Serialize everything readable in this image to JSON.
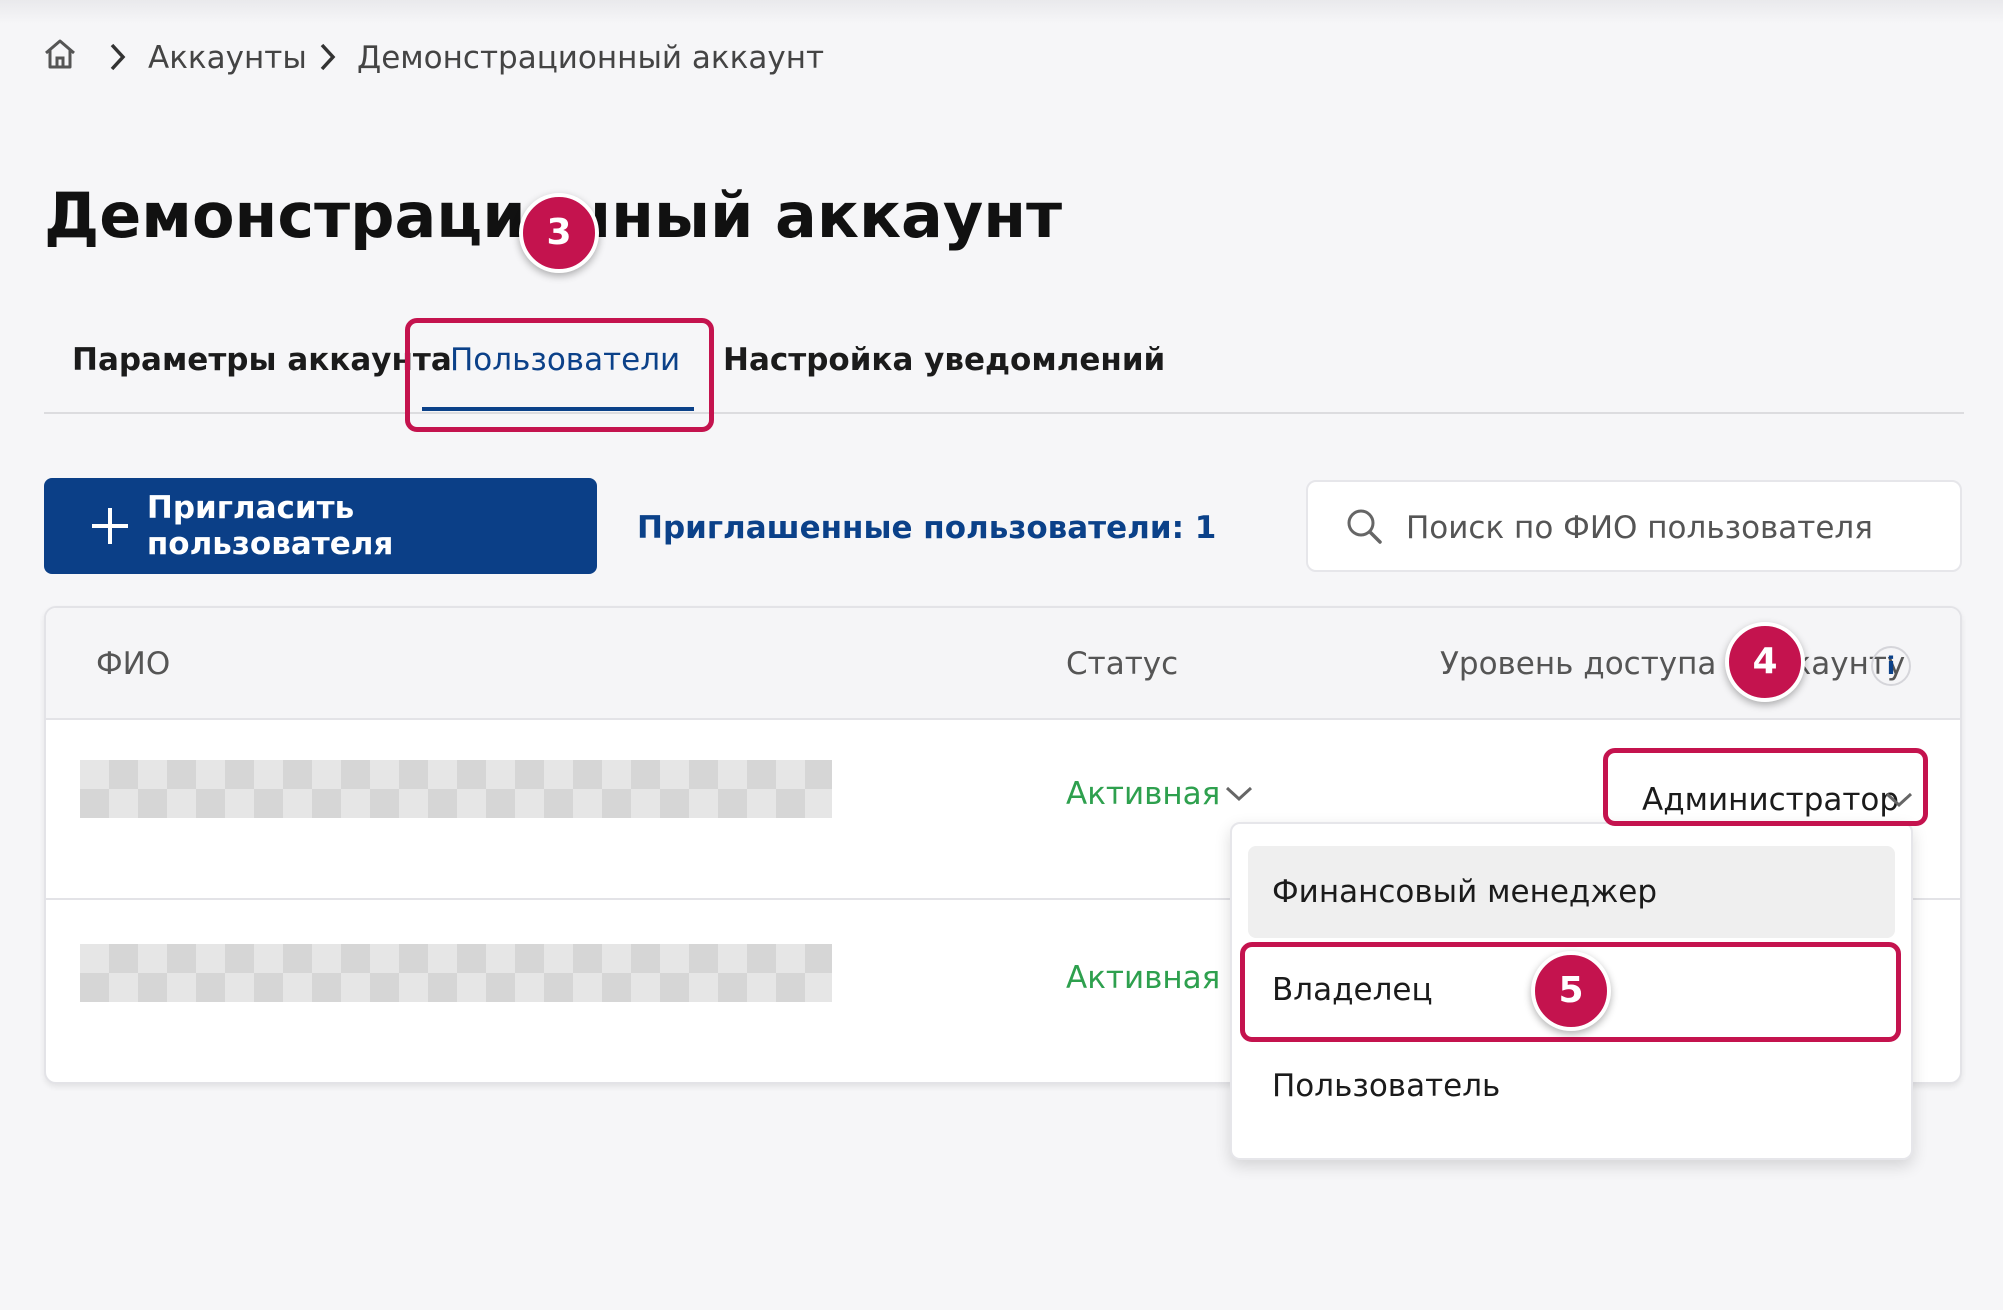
{
  "breadcrumb": {
    "home_icon": "home-icon",
    "items": [
      "Аккаунты",
      "Демонстрационный аккаунт"
    ]
  },
  "page_title": "Демонстрационный аккаунт",
  "tabs": [
    {
      "label": "Параметры аккаунта",
      "active": false
    },
    {
      "label": "Пользователи",
      "active": true
    },
    {
      "label": "Настройка уведомлений",
      "active": false
    }
  ],
  "toolbar": {
    "invite_label": "Пригласить пользователя",
    "invited_link": "Приглашенные пользователи: 1",
    "search_placeholder": "Поиск по ФИО пользователя"
  },
  "table": {
    "columns": [
      "ФИО",
      "Статус",
      "Уровень доступа к аккаунту"
    ],
    "info_icon_glyph": "i",
    "rows": [
      {
        "name_hidden": true,
        "status": "Активная",
        "role": "Администратор"
      },
      {
        "name_hidden": true,
        "status": "Активная"
      }
    ]
  },
  "role_dropdown": {
    "options": [
      "Финансовый менеджер",
      "Владелец",
      "Пользователь"
    ]
  },
  "annotations": [
    "3",
    "4",
    "5"
  ],
  "colors": {
    "primary": "#0b3f87",
    "link": "#0b4189",
    "status_active": "#2ea04e",
    "annotation": "#c4134e"
  }
}
